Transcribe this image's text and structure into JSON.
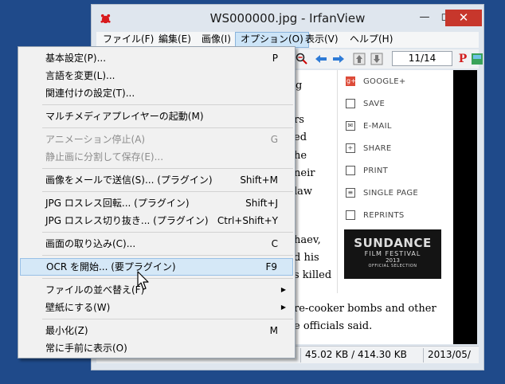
{
  "window": {
    "title": "WS000000.jpg - IrfanView"
  },
  "menubar": {
    "items": [
      "ファイル(F)",
      "編集(E)",
      "画像(I)",
      "オプション(O)",
      "表示(V)",
      "ヘルプ(H)"
    ]
  },
  "toolbar": {
    "page_counter": "11/14",
    "p_icon": "P"
  },
  "article": {
    "lines": [
      "g",
      "rs",
      "ed",
      "he",
      "neir",
      "law",
      "haev,",
      "d his",
      "s killed",
      "re-cooker bombs and other",
      "e officials said."
    ]
  },
  "share_panel": {
    "items": [
      "GOOGLE+",
      "SAVE",
      "E-MAIL",
      "SHARE",
      "PRINT",
      "SINGLE PAGE",
      "REPRINTS"
    ],
    "icons": [
      "google-plus-icon",
      "folder-icon",
      "mail-icon",
      "plus-box-icon",
      "printer-icon",
      "page-icon",
      "reprints-icon"
    ],
    "ad": {
      "line1": "SUNDANCE",
      "line2": "FILM FESTIVAL",
      "line3": "2013",
      "line4": "OFFICIAL SELECTION"
    }
  },
  "statusbar": {
    "size": "45.02 KB / 414.30 KB",
    "date": "2013/05/"
  },
  "dropdown": {
    "items": [
      {
        "label": "基本設定(P)...",
        "shortcut": "P"
      },
      {
        "label": "言語を変更(L)...",
        "shortcut": ""
      },
      {
        "label": "関連付けの設定(T)...",
        "shortcut": ""
      },
      {
        "label": "マルチメディアプレイヤーの起動(M)",
        "shortcut": ""
      },
      {
        "label": "アニメーション停止(A)",
        "shortcut": "G"
      },
      {
        "label": "静止画に分割して保存(E)...",
        "shortcut": ""
      },
      {
        "label": "画像をメールで送信(S)... (プラグイン)",
        "shortcut": "Shift+M"
      },
      {
        "label": "JPG ロスレス回転... (プラグイン)",
        "shortcut": "Shift+J"
      },
      {
        "label": "JPG ロスレス切り抜き... (プラグイン)",
        "shortcut": "Ctrl+Shift+Y"
      },
      {
        "label": "画面の取り込み(C)...",
        "shortcut": "C"
      },
      {
        "label": "OCR を開始... (要プラグイン)",
        "shortcut": "F9"
      },
      {
        "label": "ファイルの並べ替え(F)",
        "shortcut": ""
      },
      {
        "label": "壁紙にする(W)",
        "shortcut": ""
      },
      {
        "label": "最小化(Z)",
        "shortcut": "M"
      },
      {
        "label": "常に手前に表示(O)",
        "shortcut": ""
      }
    ]
  },
  "colors": {
    "accent": "#cce4f7",
    "close": "#c7372c",
    "desktop": "#1f4a8a"
  }
}
